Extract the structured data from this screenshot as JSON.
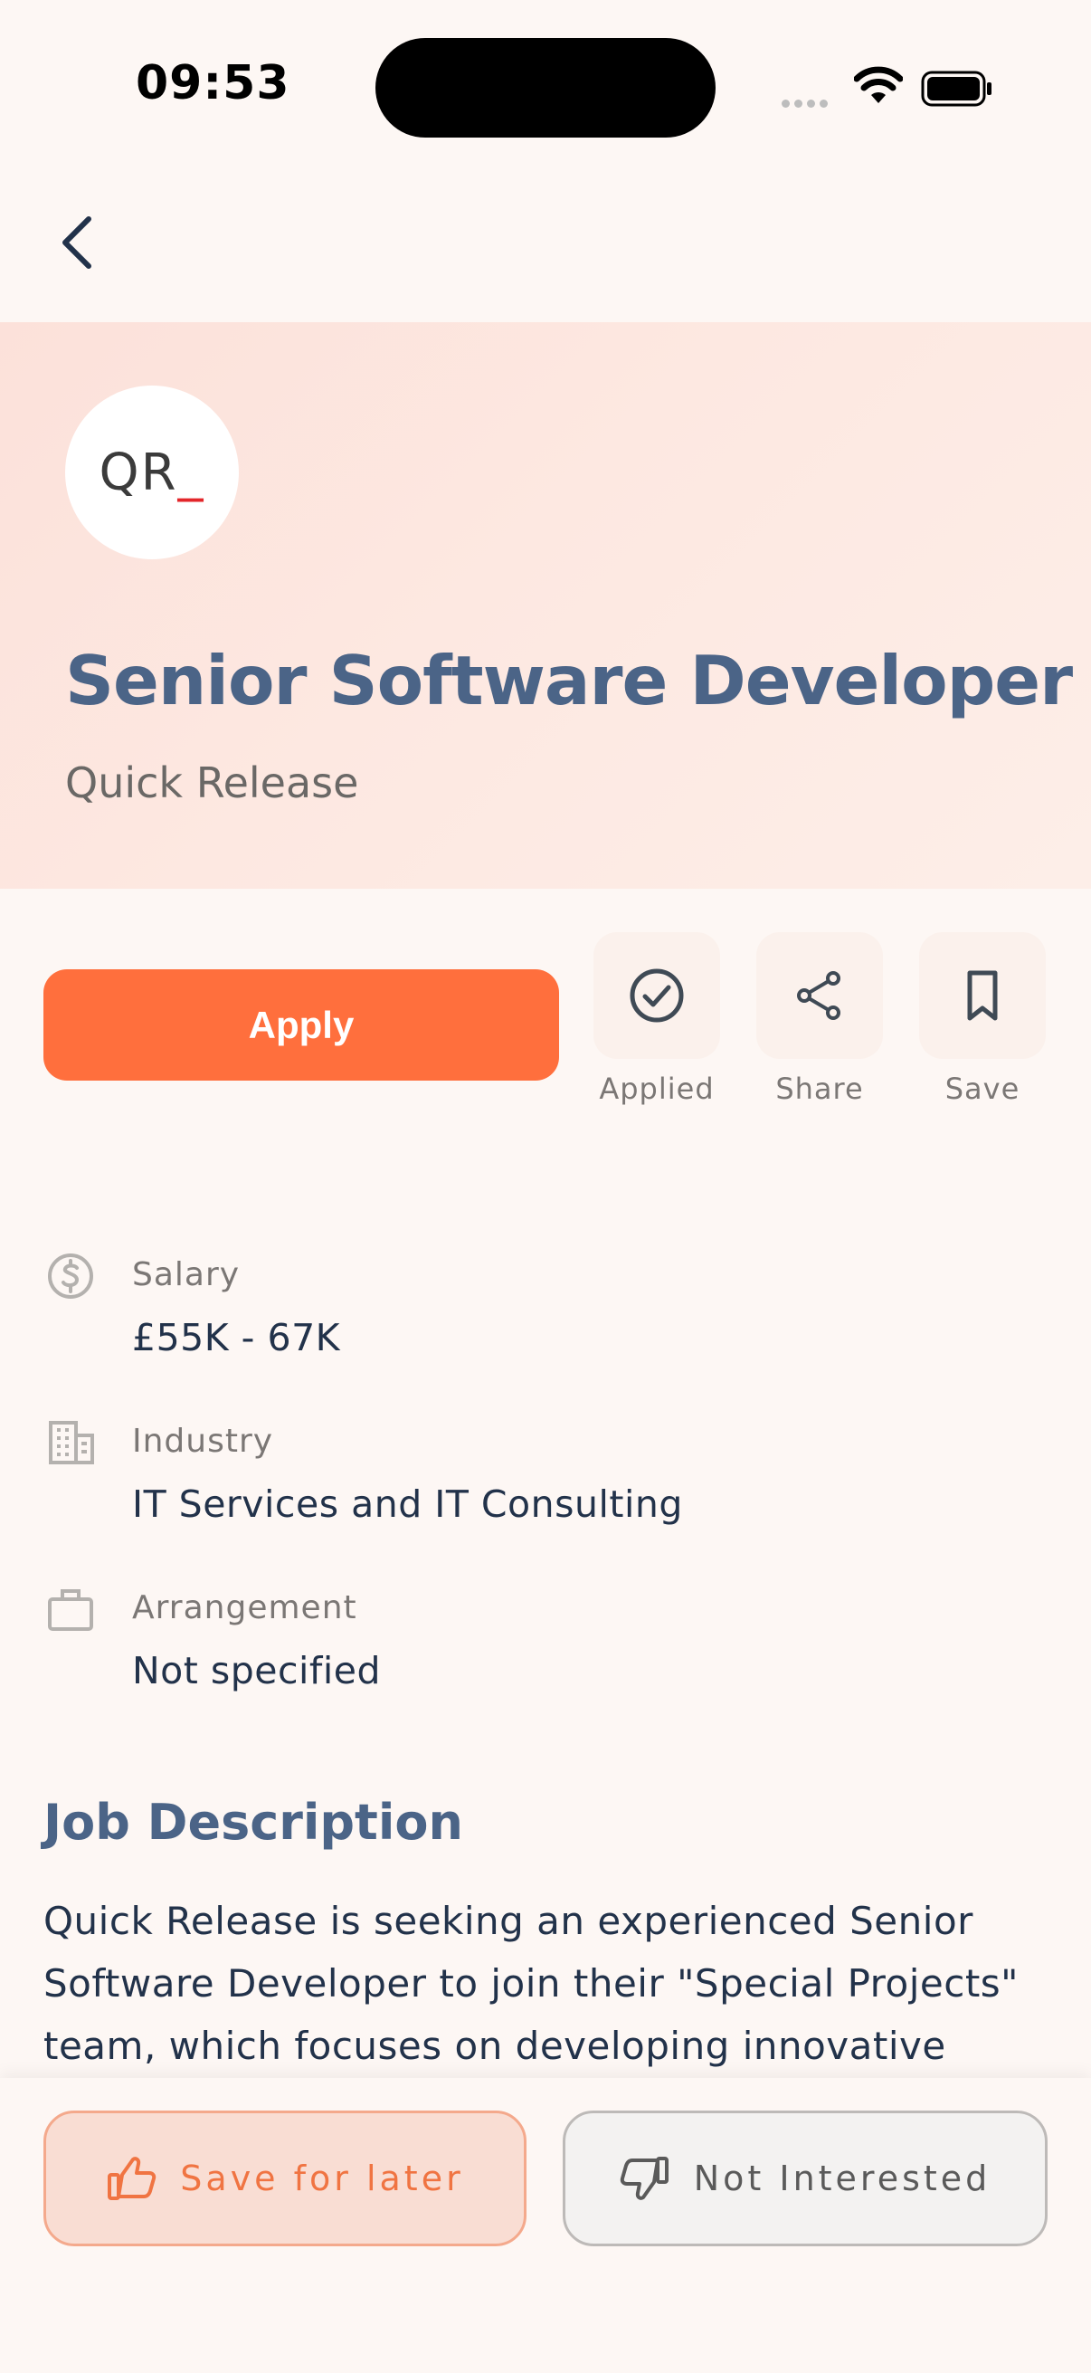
{
  "status_bar": {
    "time": "09:53"
  },
  "header": {
    "logo_text": "QR",
    "logo_underscore": "_",
    "job_title": "Senior Software Developer",
    "company": "Quick Release"
  },
  "actions": {
    "apply_label": "Apply",
    "applied_label": "Applied",
    "share_label": "Share",
    "save_label": "Save"
  },
  "details": [
    {
      "label": "Salary",
      "value": "£55K - 67K",
      "icon": "dollar-circle-icon"
    },
    {
      "label": "Industry",
      "value": "IT Services and IT Consulting",
      "icon": "building-icon"
    },
    {
      "label": "Arrangement",
      "value": "Not specified",
      "icon": "briefcase-icon"
    }
  ],
  "description": {
    "heading": "Job Description",
    "text": "Quick Release is seeking an experienced Senior Software Developer to join their \"Special Projects\" team, which focuses on developing innovative tools"
  },
  "bottom": {
    "save_for_later_label": "Save for later",
    "not_interested_label": "Not Interested"
  },
  "colors": {
    "accent": "#ff6f3d",
    "title": "#4b6487",
    "background": "#fdf7f4"
  }
}
